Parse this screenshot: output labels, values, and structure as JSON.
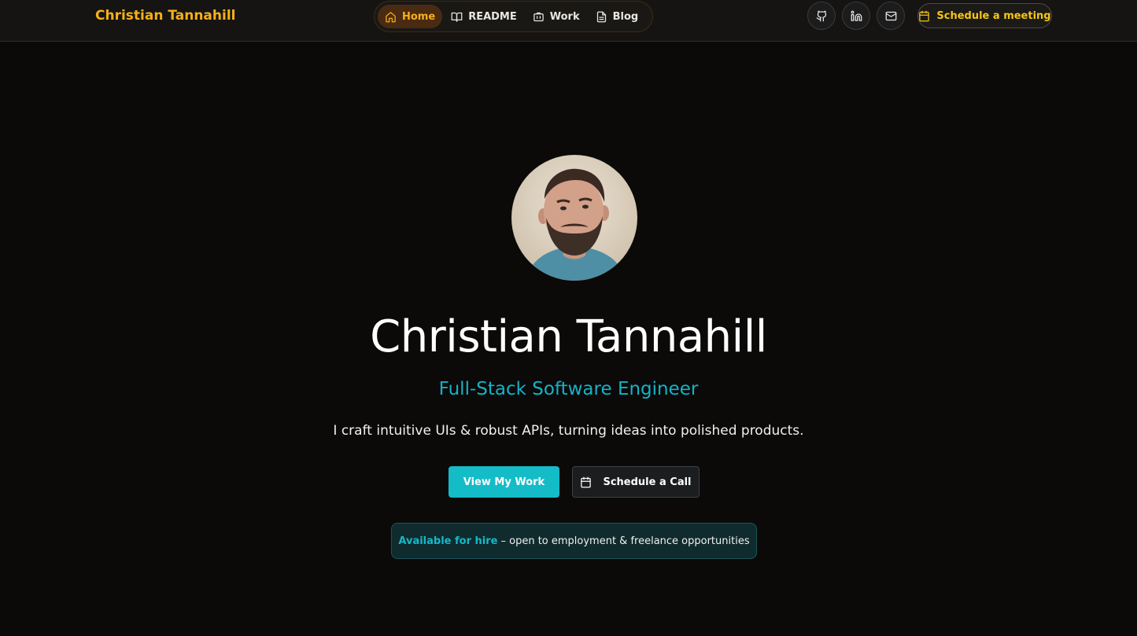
{
  "header": {
    "brand": "Christian Tannahill",
    "nav": [
      {
        "label": "Home",
        "icon": "home-icon",
        "active": true
      },
      {
        "label": "README",
        "icon": "book-icon",
        "active": false
      },
      {
        "label": "Work",
        "icon": "briefcase-icon",
        "active": false
      },
      {
        "label": "Blog",
        "icon": "document-icon",
        "active": false
      }
    ],
    "social": [
      {
        "icon": "github-icon"
      },
      {
        "icon": "linkedin-icon"
      },
      {
        "icon": "mail-icon"
      }
    ],
    "schedule_label": "Schedule a meeting"
  },
  "hero": {
    "avatar_icon": "profile-photo",
    "name": "Christian Tannahill",
    "role": "Full-Stack Software Engineer",
    "tagline": "I craft intuitive UIs & robust APIs, turning ideas into polished products.",
    "primary_cta": "View My Work",
    "secondary_cta": "Schedule a Call",
    "hire_highlight": "Available for hire",
    "hire_text": "– open to employment & freelance opportunities"
  },
  "colors": {
    "background": "#0b0a09",
    "brand": "#f5b019",
    "accent": "#14bcc8"
  }
}
